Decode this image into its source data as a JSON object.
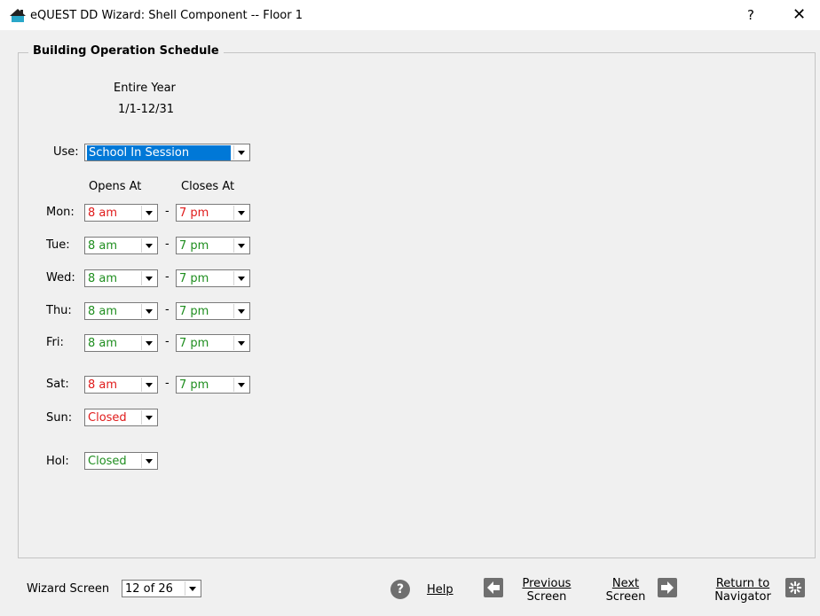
{
  "window": {
    "title": "eQUEST DD Wizard:  Shell Component  --  Floor 1",
    "help_button": "?",
    "close_button": "✕"
  },
  "group_title": "Building Operation Schedule",
  "period": {
    "name": "Entire Year",
    "range": "1/1-12/31"
  },
  "use": {
    "label": "Use:",
    "value": "School In Session"
  },
  "headers": {
    "opens": "Opens At",
    "closes": "Closes At"
  },
  "days": [
    {
      "label": "Mon:",
      "open": "8 am",
      "close": "7 pm",
      "open_color": "red",
      "close_color": "red"
    },
    {
      "label": "Tue:",
      "open": "8 am",
      "close": "7 pm",
      "open_color": "green",
      "close_color": "green"
    },
    {
      "label": "Wed:",
      "open": "8 am",
      "close": "7 pm",
      "open_color": "green",
      "close_color": "green"
    },
    {
      "label": "Thu:",
      "open": "8 am",
      "close": "7 pm",
      "open_color": "green",
      "close_color": "green"
    },
    {
      "label": "Fri:",
      "open": "8 am",
      "close": "7 pm",
      "open_color": "green",
      "close_color": "green"
    },
    {
      "label": "Sat:",
      "open": "8 am",
      "close": "7 pm",
      "open_color": "red",
      "close_color": "green"
    }
  ],
  "sun": {
    "label": "Sun:",
    "value": "Closed",
    "color": "red"
  },
  "hol": {
    "label": "Hol:",
    "value": "Closed",
    "color": "green"
  },
  "separator": "-",
  "footer": {
    "wizard_screen_label": "Wizard Screen",
    "wizard_screen_value": "12 of 26",
    "help": "Help",
    "previous_line1": "Previous",
    "previous_line2": "Screen",
    "next_line1": "Next",
    "next_line2": "Screen",
    "return_line1": "Return to",
    "return_line2": "Navigator"
  },
  "colors": {
    "red": "#e01b1b",
    "green": "#1f8e1f",
    "selection": "#0078d7"
  }
}
